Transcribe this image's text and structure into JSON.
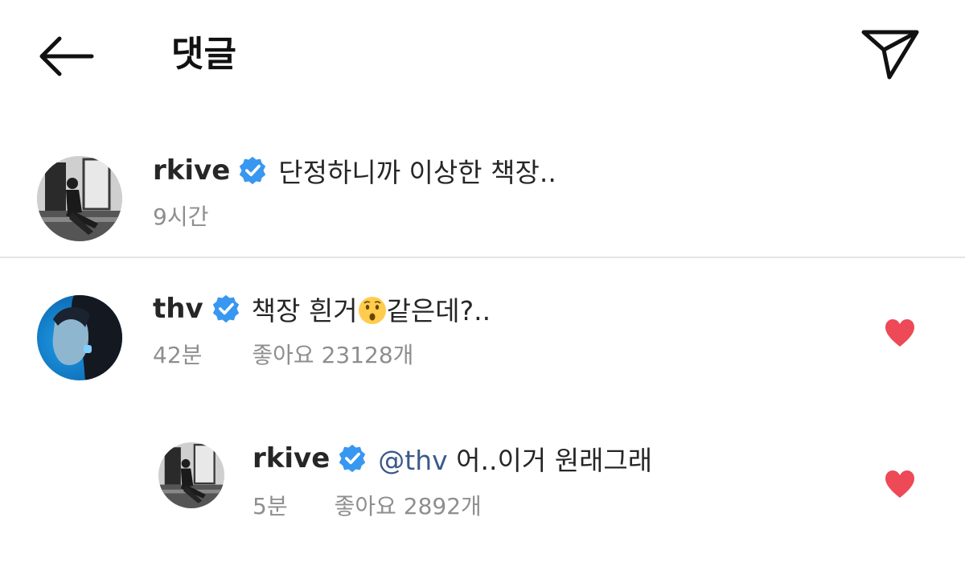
{
  "header": {
    "title": "댓글"
  },
  "caption_comment": {
    "username": "rkive",
    "text": "단정하니까 이상한 책장..",
    "time": "9시간"
  },
  "comments": [
    {
      "username": "thv",
      "text_before": "책장 흰거",
      "emoji": "hushed-face",
      "text_after": "같은데?..",
      "time": "42분",
      "likes": "좋아요 23128개"
    },
    {
      "username": "rkive",
      "mention": "@thv",
      "text": "어..이거 원래그래",
      "time": "5분",
      "likes": "좋아요 2892개"
    }
  ],
  "colors": {
    "verified": "#3897f0",
    "heart": "#ed4956",
    "meta": "#8e8e8e",
    "divider": "#e4e4e4"
  },
  "icons": [
    "back-arrow-icon",
    "send-icon",
    "verified-badge-icon",
    "heart-icon",
    "hushed-face-emoji"
  ]
}
